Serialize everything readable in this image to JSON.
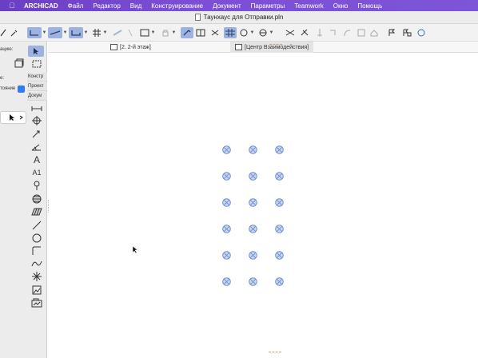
{
  "menubar": {
    "apple_icon": "apple-icon",
    "app_name": "ARCHICAD",
    "items": [
      "Файл",
      "Редактор",
      "Вид",
      "Конструирование",
      "Документ",
      "Параметры",
      "Teamwork",
      "Окно",
      "Помощь"
    ]
  },
  "window": {
    "title": "Таунхаус для Отправки.pln"
  },
  "tabs": [
    {
      "label": "[2. 2-й этаж]",
      "icon": "floor-plan-icon"
    },
    {
      "label": "[Центр Взаимодействия]",
      "icon": "collaboration-icon"
    }
  ],
  "left_panel": {
    "labels": [
      "ацию:",
      "е:",
      "тояние"
    ],
    "sections": [
      "Констр",
      "Проект",
      "Докум"
    ],
    "tools": [
      "dimension-icon",
      "level-dimension-icon",
      "elevation-dimension-icon",
      "angle-dimension-icon",
      "text-icon",
      "label-icon",
      "marker-icon",
      "fill-icon",
      "hatch-icon",
      "line-icon",
      "circle-icon",
      "polyline-icon",
      "spline-icon",
      "hotspot-icon",
      "figure-icon",
      "drawing-icon"
    ],
    "tool_glyphs": {
      "text": "A",
      "label": "A1"
    }
  },
  "canvas": {
    "markers": [
      {
        "row": 1,
        "col": 1
      },
      {
        "row": 1,
        "col": 2
      },
      {
        "row": 1,
        "col": 3
      },
      {
        "row": 2,
        "col": 1
      },
      {
        "row": 2,
        "col": 2
      },
      {
        "row": 2,
        "col": 3
      },
      {
        "row": 3,
        "col": 1
      },
      {
        "row": 3,
        "col": 2
      },
      {
        "row": 3,
        "col": 3
      },
      {
        "row": 4,
        "col": 1
      },
      {
        "row": 4,
        "col": 2
      },
      {
        "row": 4,
        "col": 3
      },
      {
        "row": 5,
        "col": 1
      },
      {
        "row": 5,
        "col": 2
      },
      {
        "row": 5,
        "col": 3
      },
      {
        "row": 6,
        "col": 1
      },
      {
        "row": 6,
        "col": 2
      },
      {
        "row": 6,
        "col": 3
      }
    ]
  },
  "colors": {
    "menubar": "#7b4fd6",
    "active_tool": "#9db3df",
    "marker_fill": "#c9d8f2",
    "marker_stroke": "#6f8fcf"
  }
}
